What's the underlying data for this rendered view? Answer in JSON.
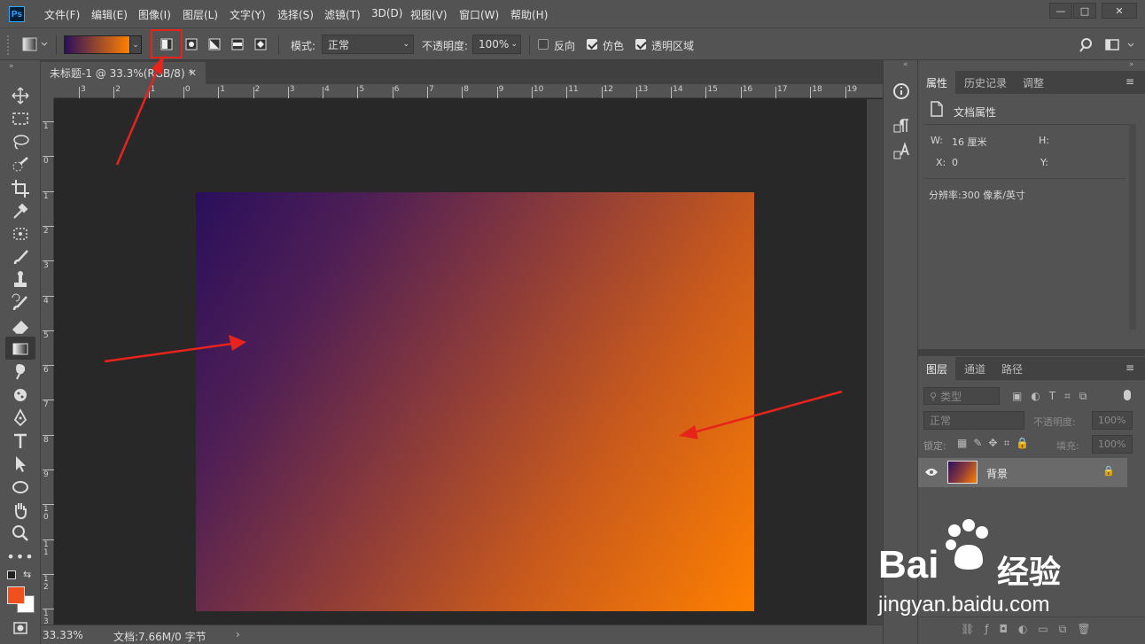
{
  "app": {
    "logo": "Ps"
  },
  "menu": [
    "文件(F)",
    "编辑(E)",
    "图像(I)",
    "图层(L)",
    "文字(Y)",
    "选择(S)",
    "滤镜(T)",
    "3D(D)",
    "视图(V)",
    "窗口(W)",
    "帮助(H)"
  ],
  "window_controls": [
    "—",
    "□",
    "✕"
  ],
  "options": {
    "mode_label": "模式:",
    "mode_value": "正常",
    "opacity_label": "不透明度:",
    "opacity_value": "100%",
    "reverse_label": "反向",
    "dither_label": "仿色",
    "transparency_label": "透明区域",
    "reverse_checked": false,
    "dither_checked": true,
    "transparency_checked": true,
    "gradient_colors": [
      "#2a0f5c",
      "#ff8000"
    ]
  },
  "document": {
    "tab_title": "未标题-1 @ 33.3%(RGB/8) *",
    "zoom": "33.33%",
    "doc_info": "文档:7.66M/0 字节",
    "ruler_top": [
      "3",
      "2",
      "1",
      "0",
      "1",
      "2",
      "3",
      "4",
      "5",
      "6",
      "7",
      "8",
      "9",
      "10",
      "11",
      "12",
      "13",
      "14",
      "15",
      "16",
      "17",
      "18",
      "19"
    ],
    "ruler_left": [
      "1",
      "0",
      "1",
      "2",
      "3",
      "4",
      "5",
      "6",
      "7",
      "8",
      "9",
      "1\n0",
      "1\n1",
      "1\n2",
      "1\n3"
    ],
    "gradient_start": "#2a0f5c",
    "gradient_end": "#ff8000"
  },
  "properties_panel": {
    "tabs": [
      "属性",
      "历史记录",
      "调整"
    ],
    "title": "文档属性",
    "w_label": "W:",
    "w_value": "16 厘米",
    "h_label": "H:",
    "x_label": "X:",
    "x_value": "0",
    "y_label": "Y:",
    "resolution": "分辨率:300 像素/英寸"
  },
  "layers_panel": {
    "tabs": [
      "图层",
      "通道",
      "路径"
    ],
    "filter_placeholder": "类型",
    "blend_mode": "正常",
    "opacity_label": "不透明度:",
    "opacity_value": "100%",
    "lock_label": "锁定:",
    "fill_label": "填充:",
    "fill_value": "100%",
    "layer_name": "背景"
  },
  "colors": {
    "foreground": "#f0501e",
    "background": "#ffffff",
    "annotation": "#e8231c"
  },
  "watermark": {
    "brand": "Bai",
    "brand2": "经验",
    "url": "jingyan.baidu.com"
  }
}
